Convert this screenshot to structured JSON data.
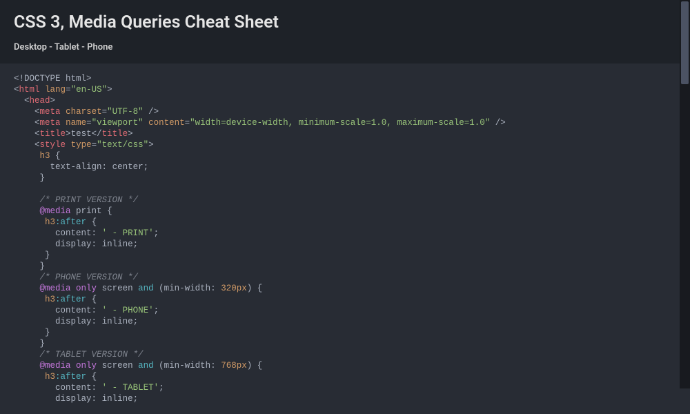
{
  "header": {
    "title": "CSS 3, Media Queries Cheat Sheet",
    "subtitle": "Desktop - Tablet - Phone"
  },
  "code": {
    "l1_doctype": "<!DOCTYPE html>",
    "l2_tag": "html",
    "l2_attr": "lang",
    "l2_val": "\"en-US\"",
    "l3_tag": "head",
    "l4_tag": "meta",
    "l4_attr": "charset",
    "l4_val": "\"UTF-8\"",
    "l5_tag": "meta",
    "l5_attr1": "name",
    "l5_val1": "\"viewport\"",
    "l5_attr2": "content",
    "l5_val2": "\"width=device-width, minimum-scale=1.0, maximum-scale=1.0\"",
    "l6_tag": "title",
    "l6_text": "test",
    "l7_tag": "style",
    "l7_attr": "type",
    "l7_val": "\"text/css\"",
    "l8_sel": "h3",
    "l9_prop": "text-align",
    "l9_val": "center",
    "l12_com": "/* PRINT VERSION */",
    "l13_kw1": "@media",
    "l13_kw2": "print",
    "l14_sel": "h3",
    "l14_pseudo": ":after",
    "l15_prop": "content",
    "l15_val": "' - PRINT'",
    "l16_prop": "display",
    "l16_val": "inline",
    "l19_com": "/* PHONE VERSION */",
    "l20_kw1": "@media",
    "l20_kw2": "only",
    "l20_kw3": "screen",
    "l20_kw4": "and",
    "l20_prop": "min-width",
    "l20_num": "320px",
    "l21_sel": "h3",
    "l21_pseudo": ":after",
    "l22_prop": "content",
    "l22_val": "' - PHONE'",
    "l23_prop": "display",
    "l23_val": "inline",
    "l26_com": "/* TABLET VERSION */",
    "l27_kw1": "@media",
    "l27_kw2": "only",
    "l27_kw3": "screen",
    "l27_kw4": "and",
    "l27_prop": "min-width",
    "l27_num": "768px",
    "l28_sel": "h3",
    "l28_pseudo": ":after",
    "l29_prop": "content",
    "l29_val": "' - TABLET'",
    "l30_prop": "display",
    "l30_val": "inline"
  }
}
